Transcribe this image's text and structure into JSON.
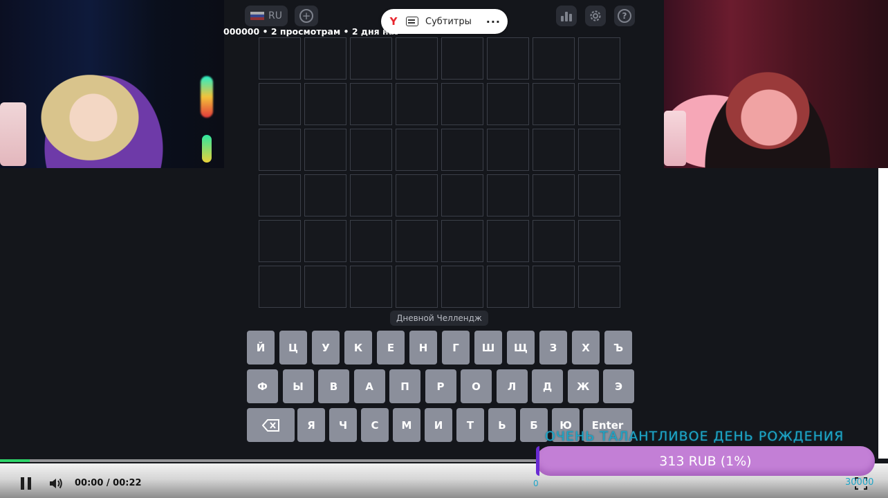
{
  "top_bar": {
    "language_label": "RU",
    "video_meta": "000000 • 2 просмотрам • 2 дня назад"
  },
  "subtitle_pill": {
    "brand_letter": "Y",
    "label": "Субтитры",
    "more": "···"
  },
  "game": {
    "rows": 6,
    "columns": 8,
    "mode_label": "Дневной Челлендж"
  },
  "keyboard": {
    "row1": [
      "Й",
      "Ц",
      "У",
      "К",
      "Е",
      "Н",
      "Г",
      "Ш",
      "Щ",
      "З",
      "Х",
      "Ъ"
    ],
    "row2": [
      "Ф",
      "Ы",
      "В",
      "А",
      "П",
      "Р",
      "О",
      "Л",
      "Д",
      "Ж",
      "Э"
    ],
    "row3": [
      "Я",
      "Ч",
      "С",
      "М",
      "И",
      "Т",
      "Ь",
      "Б",
      "Ю"
    ],
    "enter_label": "Enter",
    "backspace_icon": "backspace-icon"
  },
  "donation": {
    "title": "ОЧЕНЬ ТАЛАНТЛИВОЕ ДЕНЬ РОЖДЕНИЯ",
    "amount_text": "313 RUB (1%)",
    "progress_fraction": 0.01,
    "min_label": "0",
    "max_label": "30000"
  },
  "player": {
    "time": "00:00 / 00:22",
    "progress_fraction": 0.055
  },
  "colors": {
    "grid_border": "#3b3f48",
    "key_bg": "#8b8f9b",
    "progress_green": "#2fd46a",
    "donation_purple": "#c37fd6",
    "donation_text_cyan": "#1ea6c8",
    "yandex_red": "#e8262e"
  }
}
